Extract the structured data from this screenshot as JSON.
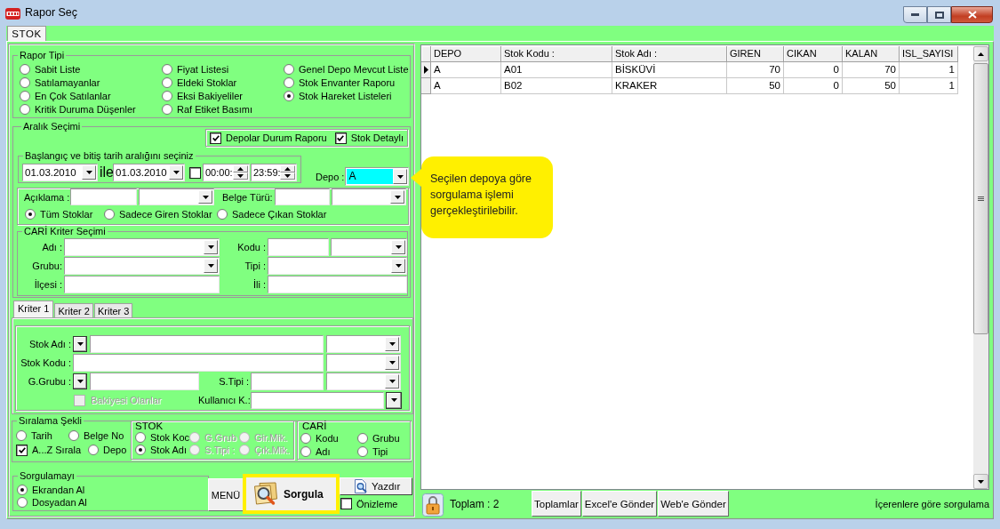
{
  "window": {
    "title": "Rapor Seç"
  },
  "tabs": [
    {
      "label": "STOK",
      "selected": true
    }
  ],
  "rapor_tipi": {
    "title": "Rapor Tipi",
    "options": [
      {
        "label": "Sabit Liste",
        "selected": false
      },
      {
        "label": "Satılamayanlar",
        "selected": false
      },
      {
        "label": "En Çok Satılanlar",
        "selected": false
      },
      {
        "label": "Kritik Duruma Düşenler",
        "selected": false
      },
      {
        "label": "Fiyat Listesi",
        "selected": false
      },
      {
        "label": "Eldeki Stoklar",
        "selected": false
      },
      {
        "label": "Eksi Bakiyeliler",
        "selected": false
      },
      {
        "label": "Raf Etiket Basımı",
        "selected": false
      },
      {
        "label": "Genel Depo Mevcut Liste",
        "selected": false
      },
      {
        "label": "Stok Envanter Raporu",
        "selected": false
      },
      {
        "label": "Stok Hareket Listeleri",
        "selected": true
      }
    ]
  },
  "aralik_secimi": {
    "title": "Aralık Seçimi",
    "options": [
      {
        "label": "Depolar Durum Raporu",
        "checked": true
      },
      {
        "label": "Stok Detaylı",
        "checked": true
      }
    ],
    "date_range": {
      "title": "Başlangıç ve bitiş tarih aralığını seçiniz",
      "start_date": "01.03.2010",
      "separator": "ile",
      "end_date": "01.03.2010",
      "time_filter": {
        "checked": false
      },
      "start_time": "00:00:",
      "end_time": "23:59:"
    },
    "depo": {
      "label": "Depo :",
      "value": "A"
    },
    "aciklama_label": "Açıklama :",
    "belge_turu_label": "Belge Türü:",
    "stock_filter": [
      {
        "label": "Tüm Stoklar",
        "selected": true
      },
      {
        "label": "Sadece Giren Stoklar",
        "selected": false
      },
      {
        "label": "Sadece Çıkan Stoklar",
        "selected": false
      }
    ],
    "cari_kriter": {
      "title": "CARİ Kriter Seçimi",
      "fields": [
        {
          "label": "Adı :",
          "kind": "combo"
        },
        {
          "label": "Kodu :",
          "kind": "text_combo"
        },
        {
          "label": "Grubu:",
          "kind": "combo"
        },
        {
          "label": "Tipi :",
          "kind": "combo"
        },
        {
          "label": "İlçesi :",
          "kind": "text"
        },
        {
          "label": "İli :",
          "kind": "text"
        }
      ]
    }
  },
  "kriter_tabs": [
    {
      "label": "Kriter 1",
      "selected": true
    },
    {
      "label": "Kriter 2",
      "selected": false
    },
    {
      "label": "Kriter 3",
      "selected": false
    }
  ],
  "kriter_1": {
    "stok_adi": "Stok Adı :",
    "stok_kodu": "Stok Kodu :",
    "g_grubu": "G.Grubu :",
    "s_tipi": "S.Tipi :",
    "kullanici": "Kullanıcı K.:",
    "bakiyesi_olanlar": {
      "label": "Bakiyesi Olanlar",
      "checked": false,
      "disabled": true
    }
  },
  "siralama": {
    "title": "Sıralama Şekli",
    "options": [
      {
        "kind": "radio",
        "label": "Tarih",
        "selected": false
      },
      {
        "kind": "radio",
        "label": "Belge No",
        "selected": false
      },
      {
        "kind": "checkbox",
        "label": "A...Z Sırala",
        "checked": true
      },
      {
        "kind": "radio",
        "label": "Depo",
        "selected": false
      }
    ],
    "stok": {
      "title": "STOK",
      "options": [
        {
          "label": "Stok Koc",
          "selected": false,
          "disabled": false
        },
        {
          "label": "G.Grub",
          "selected": false,
          "disabled": true
        },
        {
          "label": "Gir.Mik.",
          "selected": false,
          "disabled": true
        },
        {
          "label": "Stok Adı",
          "selected": true,
          "disabled": false
        },
        {
          "label": "S.Tipi :",
          "selected": false,
          "disabled": true
        },
        {
          "label": "Çık.Mik.",
          "selected": false,
          "disabled": true
        }
      ]
    },
    "cari": {
      "title": "CARİ",
      "options": [
        {
          "label": "Kodu",
          "selected": false
        },
        {
          "label": "Grubu",
          "selected": false
        },
        {
          "label": "Adı",
          "selected": false
        },
        {
          "label": "Tipi",
          "selected": false
        }
      ]
    }
  },
  "sorgulama": {
    "title": "Sorgulamayı",
    "options": [
      {
        "label": "Ekrandan Al",
        "selected": true
      },
      {
        "label": "Dosyadan Al",
        "selected": false
      }
    ]
  },
  "actions": {
    "menu": "MENÜ",
    "query": {
      "label": "Sorgula",
      "highlighted": true
    },
    "print": "Yazdır",
    "preview": {
      "label": "Önizleme",
      "checked": false
    }
  },
  "table": {
    "columns": [
      {
        "label": "DEPO",
        "kind": "text"
      },
      {
        "label": "Stok Kodu :",
        "kind": "text"
      },
      {
        "label": "Stok Adı :",
        "kind": "text"
      },
      {
        "label": "GIREN",
        "kind": "number"
      },
      {
        "label": "CIKAN",
        "kind": "number"
      },
      {
        "label": "KALAN",
        "kind": "number"
      },
      {
        "label": "ISL_SAYISI",
        "kind": "number"
      }
    ],
    "rows": [
      {
        "selected": true,
        "cells": [
          "A",
          "A01",
          "BİSKÜVİ",
          "70",
          "0",
          "70",
          "1"
        ]
      },
      {
        "selected": false,
        "cells": [
          "A",
          "B02",
          "KRAKER",
          "50",
          "0",
          "50",
          "1"
        ]
      }
    ]
  },
  "callout": {
    "text": "Seçilen depoya göre sorgulama işlemi gerçekleştirilebilir."
  },
  "status_bar": {
    "total": "Toplam : 2",
    "buttons": [
      "Toplamlar",
      "Excel'e Gönder",
      "Web'e Gönder"
    ],
    "hint": "İçerenlere göre sorgulama"
  }
}
